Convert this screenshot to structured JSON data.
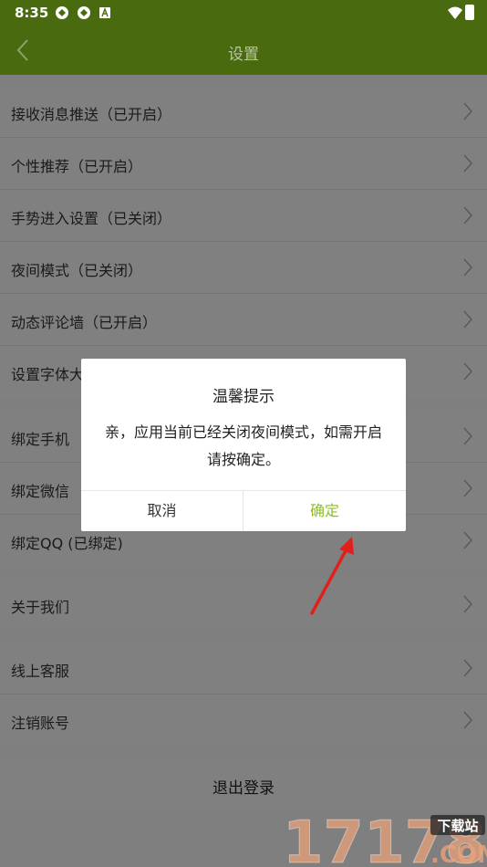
{
  "status_bar": {
    "time": "8:35",
    "icons": [
      "app-icon",
      "app-icon",
      "text-icon",
      "wifi-icon",
      "battery-icon"
    ]
  },
  "header": {
    "title": "设置",
    "back_icon": "chevron-left-icon"
  },
  "settings_groups": [
    {
      "items": [
        {
          "label": "接收消息推送（已开启）"
        },
        {
          "label": "个性推荐（已开启）"
        },
        {
          "label": "手势进入设置（已关闭）"
        },
        {
          "label": "夜间模式（已关闭）"
        },
        {
          "label": "动态评论墙（已开启）"
        },
        {
          "label": "设置字体大小"
        }
      ]
    },
    {
      "items": [
        {
          "label": "绑定手机"
        },
        {
          "label": "绑定微信"
        },
        {
          "label": "绑定QQ (已绑定)"
        }
      ]
    },
    {
      "items": [
        {
          "label": "关于我们"
        }
      ]
    },
    {
      "items": [
        {
          "label": "线上客服"
        },
        {
          "label": "注销账号"
        }
      ]
    }
  ],
  "logout": {
    "label": "退出登录"
  },
  "dialog": {
    "title": "温馨提示",
    "message": "亲，应用当前已经关闭夜间模式，如需开启请按确定。",
    "cancel_label": "取消",
    "confirm_label": "确定"
  },
  "watermark": {
    "number": "17178",
    "tag": "下载站",
    "domain": ".COM"
  },
  "colors": {
    "header_bg": "#4a6a10",
    "confirm_accent": "#8cbf22",
    "annotation_arrow": "#e0201c"
  }
}
